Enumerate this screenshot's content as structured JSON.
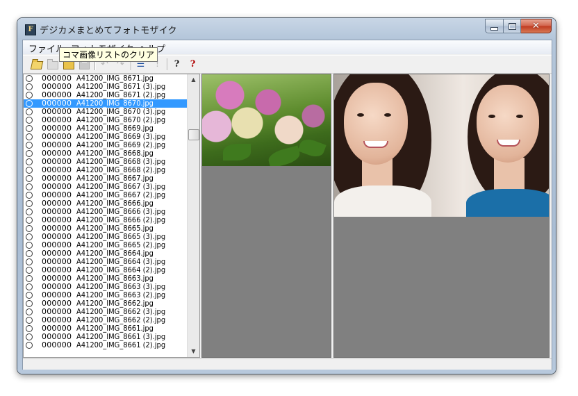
{
  "window": {
    "title": "デジカメまとめてフォトモザイク",
    "app_icon_letter": "F"
  },
  "menu": [
    "ファイル",
    "フォトモザイク",
    "ヘルプ"
  ],
  "toolbar": {
    "tooltip": "コマ画像リストのクリア",
    "help_glyph": "?",
    "about_glyph": "?",
    "stop_glyph": "!"
  },
  "list": {
    "selected_index": 3,
    "rows": [
      {
        "num": "000000",
        "name": "A41200_IMG_8671.jpg"
      },
      {
        "num": "000000",
        "name": "A41200_IMG_8671 (3).jpg"
      },
      {
        "num": "000000",
        "name": "A41200_IMG_8671 (2).jpg"
      },
      {
        "num": "000000",
        "name": "A41200_IMG_8670.jpg"
      },
      {
        "num": "000000",
        "name": "A41200_IMG_8670 (3).jpg"
      },
      {
        "num": "000000",
        "name": "A41200_IMG_8670 (2).jpg"
      },
      {
        "num": "000000",
        "name": "A41200_IMG_8669.jpg"
      },
      {
        "num": "000000",
        "name": "A41200_IMG_8669 (3).jpg"
      },
      {
        "num": "000000",
        "name": "A41200_IMG_8669 (2).jpg"
      },
      {
        "num": "000000",
        "name": "A41200_IMG_8668.jpg"
      },
      {
        "num": "000000",
        "name": "A41200_IMG_8668 (3).jpg"
      },
      {
        "num": "000000",
        "name": "A41200_IMG_8668 (2).jpg"
      },
      {
        "num": "000000",
        "name": "A41200_IMG_8667.jpg"
      },
      {
        "num": "000000",
        "name": "A41200_IMG_8667 (3).jpg"
      },
      {
        "num": "000000",
        "name": "A41200_IMG_8667 (2).jpg"
      },
      {
        "num": "000000",
        "name": "A41200_IMG_8666.jpg"
      },
      {
        "num": "000000",
        "name": "A41200_IMG_8666 (3).jpg"
      },
      {
        "num": "000000",
        "name": "A41200_IMG_8666 (2).jpg"
      },
      {
        "num": "000000",
        "name": "A41200_IMG_8665.jpg"
      },
      {
        "num": "000000",
        "name": "A41200_IMG_8665 (3).jpg"
      },
      {
        "num": "000000",
        "name": "A41200_IMG_8665 (2).jpg"
      },
      {
        "num": "000000",
        "name": "A41200_IMG_8664.jpg"
      },
      {
        "num": "000000",
        "name": "A41200_IMG_8664 (3).jpg"
      },
      {
        "num": "000000",
        "name": "A41200_IMG_8664 (2).jpg"
      },
      {
        "num": "000000",
        "name": "A41200_IMG_8663.jpg"
      },
      {
        "num": "000000",
        "name": "A41200_IMG_8663 (3).jpg"
      },
      {
        "num": "000000",
        "name": "A41200_IMG_8663 (2).jpg"
      },
      {
        "num": "000000",
        "name": "A41200_IMG_8662.jpg"
      },
      {
        "num": "000000",
        "name": "A41200_IMG_8662 (3).jpg"
      },
      {
        "num": "000000",
        "name": "A41200_IMG_8662 (2).jpg"
      },
      {
        "num": "000000",
        "name": "A41200_IMG_8661.jpg"
      },
      {
        "num": "000000",
        "name": "A41200_IMG_8661 (3).jpg"
      },
      {
        "num": "000000",
        "name": "A41200_IMG_8661 (2).jpg"
      }
    ]
  },
  "icons": {
    "app": "app-icon",
    "minimize": "minimize-icon",
    "maximize": "maximize-icon",
    "close": "close-icon",
    "open": "folder-open-icon",
    "save": "save-icon",
    "undo": "undo-icon",
    "redo": "redo-icon",
    "list": "list-icon",
    "help": "help-icon"
  },
  "colors": {
    "selection": "#3399ff",
    "tooltip_bg": "#ffffe1",
    "pane_bg": "#808080",
    "close_red": "#c0391f"
  }
}
